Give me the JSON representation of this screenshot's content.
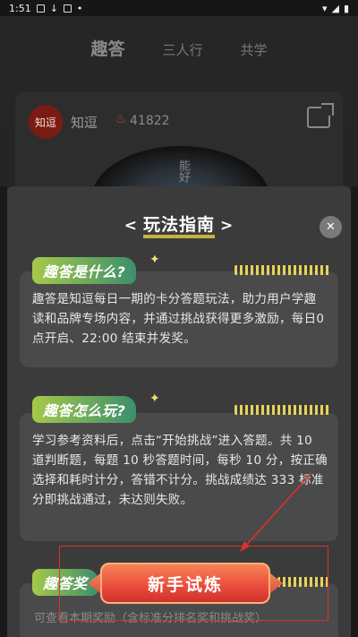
{
  "status_bar": {
    "time": "1:51"
  },
  "bg": {
    "tabs": [
      "趣答",
      "三人行",
      "共学"
    ],
    "avatar_text": "知逗",
    "channel_name": "知逗",
    "fire_count": "41822",
    "ring_text": "能好"
  },
  "modal": {
    "title": "玩法指南",
    "left_chevron": "<",
    "right_chevron": ">",
    "close": "✕",
    "sections": [
      {
        "heading": "趣答是什么?",
        "body": "趣答是知逗每日一期的卡分答题玩法，助力用户学趣读和品牌专场内容，并通过挑战获得更多激励，每日0 点开启、22:00 结束并发奖。"
      },
      {
        "heading": "趣答怎么玩?",
        "body": "学习参考资料后，点击“开始挑战”进入答题。共 10 道判断题，每题 10 秒答题时间，每秒 10 分，按正确选择和耗时计分，答错不计分。挑战成绩达 333 标准分即挑战通过，未达则失败。"
      },
      {
        "heading": "趣答奖",
        "body": "可查看本期奖励（含标准分排名奖和挑战奖）"
      }
    ],
    "cta_label": "新手试炼"
  }
}
